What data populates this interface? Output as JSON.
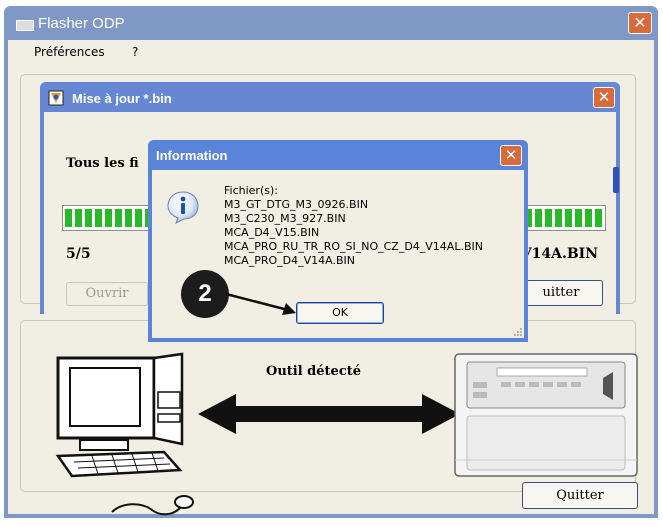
{
  "main_window": {
    "title": "Flasher ODP",
    "close_glyph": "✕",
    "menu": [
      "Préférences",
      "?"
    ],
    "outil_label": "Outil détecté",
    "quit_label": "Quitter",
    "icons": [
      "app-icon",
      "computer-illustration",
      "double-arrow",
      "device-illustration"
    ]
  },
  "update_window": {
    "title": "Mise à jour *.bin",
    "close_glyph": "✕",
    "label_partial": "Tous les fi",
    "progress_fraction": 1.0,
    "count": "5/5",
    "current_file_partial": "V14A.BIN",
    "open_label_partial": "Ouvrir",
    "quit_label_partial": "uitter"
  },
  "info_dialog": {
    "title": "Information",
    "close_glyph": "✕",
    "icon": "info-icon",
    "lines": [
      "Fichier(s):",
      "M3_GT_DTG_M3_0926.BIN",
      "M3_C230_M3_927.BIN",
      "MCA_D4_V15.BIN",
      "MCA_PRO_RU_TR_RO_SI_NO_CZ_D4_V14AL.BIN",
      "MCA_PRO_D4_V14A.BIN"
    ],
    "ok_label": "OK"
  },
  "annotation": {
    "step_number": "2"
  },
  "colors": {
    "main_title": "#7f98c6",
    "update_title": "#6587d4",
    "info_title": "#5a84d8",
    "progress_fill": "#28b828",
    "client_bg": "#f1efe4"
  }
}
